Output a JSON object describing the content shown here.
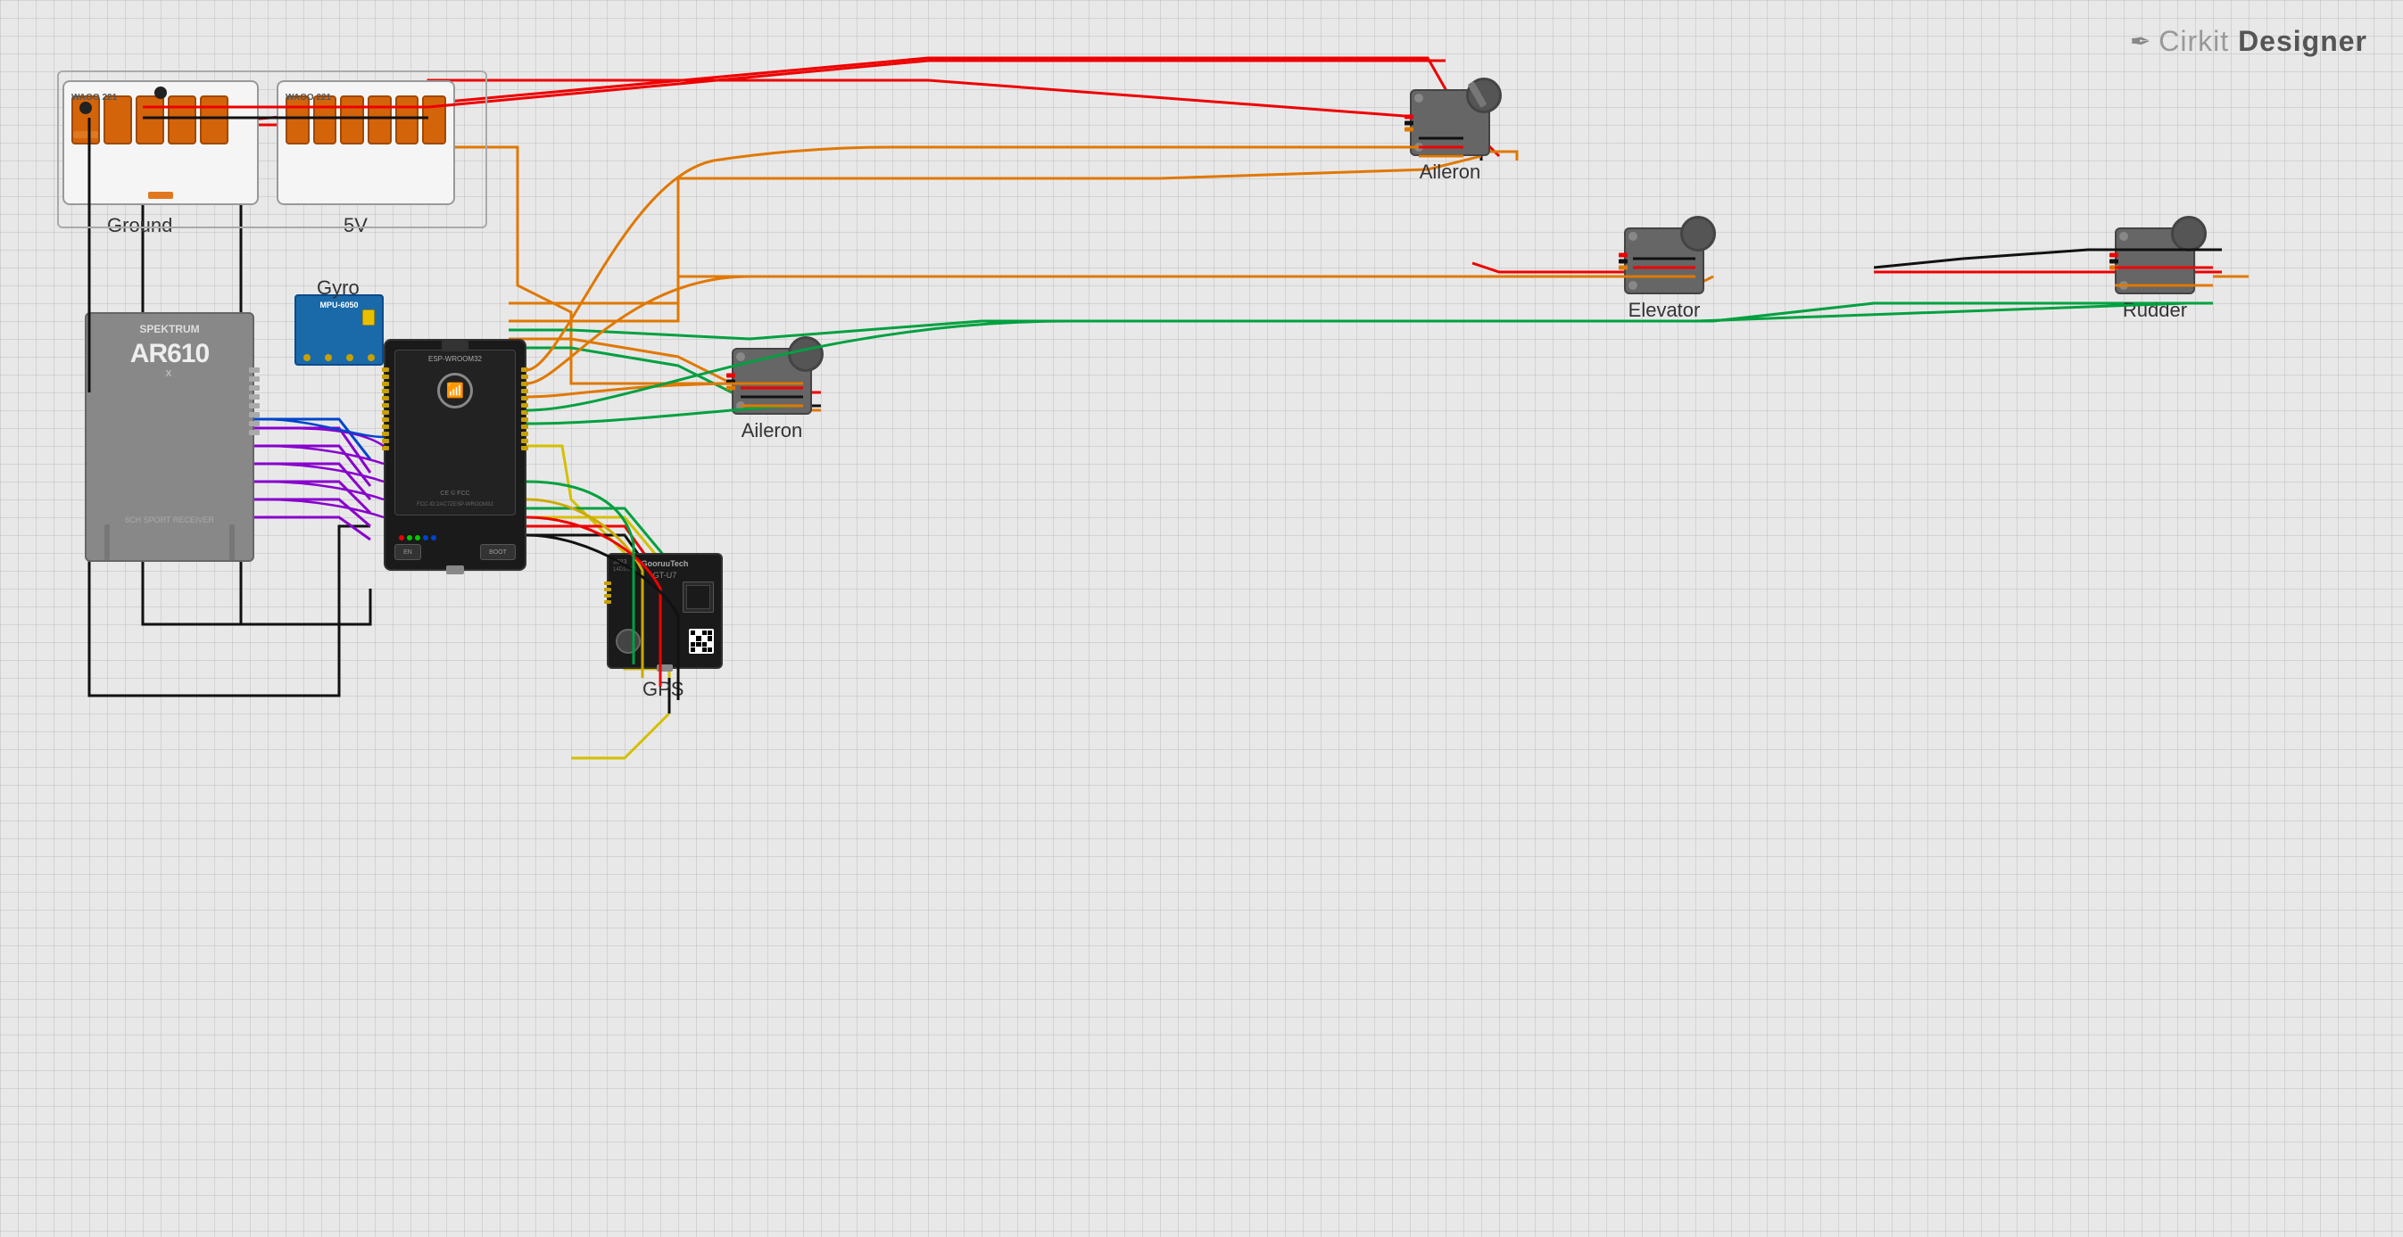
{
  "brand": {
    "icon": "✏️",
    "prefix": "Cirkit ",
    "suffix": "Designer"
  },
  "components": {
    "ground_label": "Ground",
    "voltage_label": "5V",
    "gyro_label": "Gyro",
    "aileron1_label": "Aileron",
    "aileron2_label": "Aileron",
    "elevator_label": "Elevator",
    "rudder_label": "Rudder",
    "gps_label": "GPS",
    "esp32_text": "ESP-WROOM32",
    "ar610_text": "SPEKTRUM\nAR610\nX\n6CH SPORT RECEIVER"
  },
  "colors": {
    "wago_orange": "#d4640a",
    "servo_gray": "#666",
    "pcb_blue": "#1a6aaa",
    "pcb_dark": "#1a1a1a",
    "receiver_gray": "#888",
    "bg": "#e8e8e8",
    "grid": "#cccccc"
  }
}
